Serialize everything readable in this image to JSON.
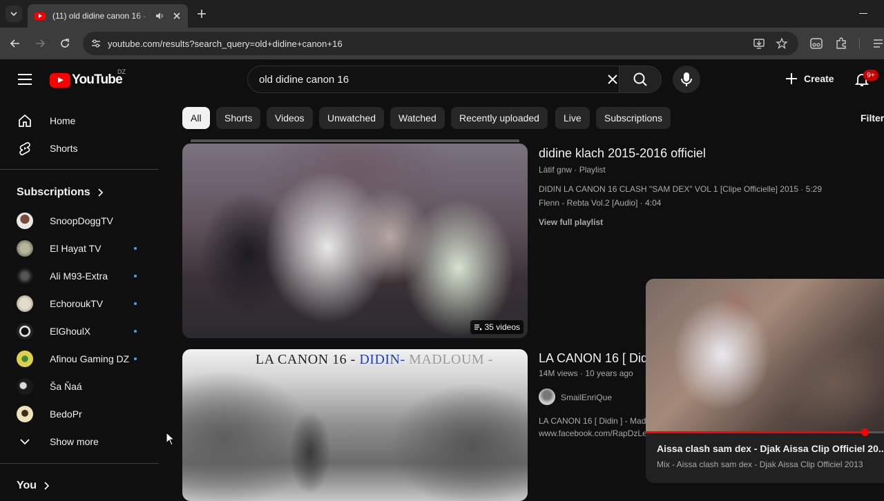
{
  "browser": {
    "tab_title": "(11) old didine canon 16 - YouTube",
    "url": "youtube.com/results?search_query=old+didine+canon+16"
  },
  "masthead": {
    "logo_text": "YouTube",
    "country_code": "DZ",
    "search_value": "old didine canon 16",
    "create_label": "Create",
    "notification_count": "9+"
  },
  "sidebar": {
    "home": "Home",
    "shorts": "Shorts",
    "subscriptions_heading": "Subscriptions",
    "channels": [
      {
        "name": "SnoopDoggTV",
        "live": false,
        "color": "#d9d9d9"
      },
      {
        "name": "El Hayat TV",
        "live": true,
        "color": "#9c9a86"
      },
      {
        "name": "Ali M93-Extra",
        "live": true,
        "color": "#2a2a2a"
      },
      {
        "name": "EchoroukTV",
        "live": true,
        "color": "#c9c3b5"
      },
      {
        "name": "ElGhoulX",
        "live": true,
        "color": "#e8e8e8"
      },
      {
        "name": "Afinou Gaming DZ",
        "live": true,
        "color": "#c7b64a"
      },
      {
        "name": "Ša Ňaá",
        "live": false,
        "color": "#1e1e1e"
      },
      {
        "name": "BedoPr",
        "live": false,
        "color": "#e6d4a8"
      }
    ],
    "show_more": "Show more",
    "you_heading": "You"
  },
  "chips": [
    "All",
    "Shorts",
    "Videos",
    "Unwatched",
    "Watched",
    "Recently uploaded",
    "Live",
    "Subscriptions"
  ],
  "filters_label": "Filter",
  "results": [
    {
      "title": "didine  klach 2015-2016 officiel",
      "channel_meta": "Làtif gnw · Playlist",
      "items": [
        "DIDIN LA CANON 16 CLASH \"SAM DEX\" VOL 1 [Clipe Officielle] 2015 · 5:29",
        "Flenn - Rebta Vol.2 [Audio] · 4:04"
      ],
      "view_full": "View full playlist",
      "badge": "35 videos"
    },
    {
      "title": "LA CANON 16 [ Didi",
      "meta": "14M views · 10 years ago",
      "channel": "SmailEnriQue",
      "desc1": "LA CANON 16 [ Didin ] - Madl",
      "desc2": "www.facebook.com/RapDzLe",
      "thumb_title_a": "LA CANON 16 -",
      "thumb_title_b": "DIDIN-",
      "thumb_title_c": " MADLOUM -"
    }
  ],
  "miniplayer": {
    "title": "Aissa clash sam dex - Djak Aissa Clip Officiel 20...",
    "subtitle": "Mix - Aissa clash sam dex - Djak Aissa Clip Officiel 2013",
    "progress": 0.92
  }
}
